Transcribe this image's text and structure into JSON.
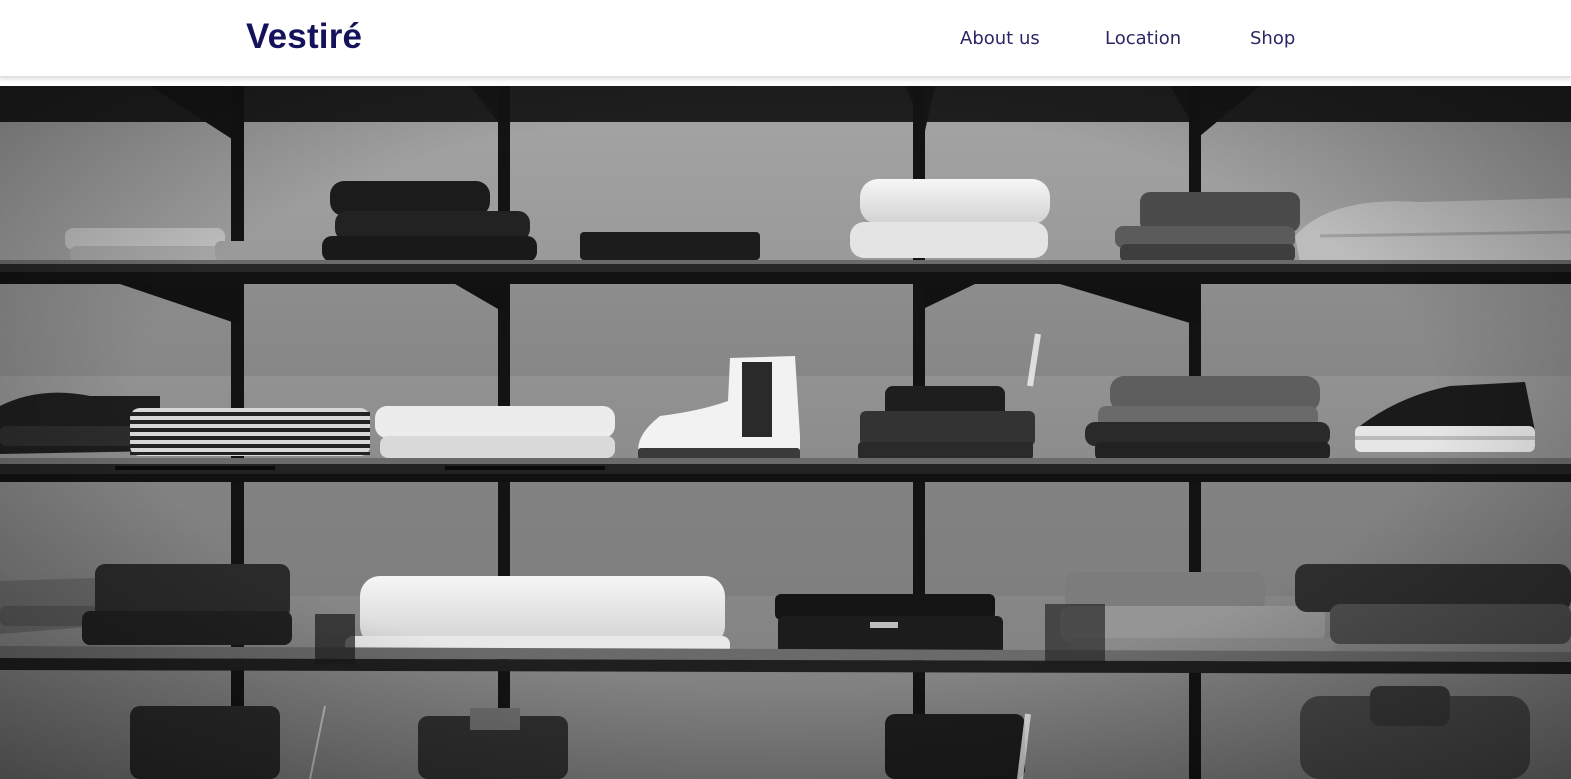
{
  "header": {
    "brand": "Vestiré",
    "nav": [
      {
        "label": "About us"
      },
      {
        "label": "Location"
      },
      {
        "label": "Shop"
      }
    ]
  },
  "colors": {
    "brand": "#15125c",
    "nav_text": "#2a2766",
    "background": "#ffffff"
  },
  "hero": {
    "image": "black-and-white-photo-of-clothing-store-shelves"
  }
}
